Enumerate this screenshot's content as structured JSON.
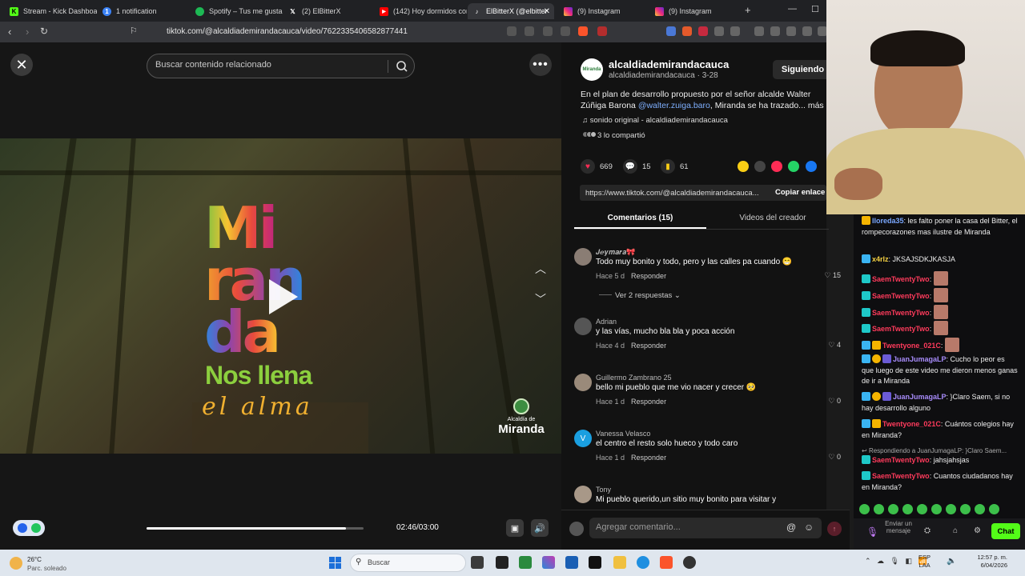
{
  "browser": {
    "tabs": [
      {
        "label": "Stream - Kick Dashboard",
        "icon": "kick-icon",
        "color": "#53fc18"
      },
      {
        "label": "1 notification",
        "icon": "notification-icon",
        "color": "#3b82f6"
      },
      {
        "label": "Spotify – Tus me gusta",
        "icon": "spotify-icon",
        "color": "#1db954"
      },
      {
        "label": "(2) ElBitterX",
        "icon": "x-icon",
        "color": "#000000"
      },
      {
        "label": "(142) Hoy dormidos con",
        "icon": "youtube-icon",
        "color": "#ff0000"
      },
      {
        "label": "ElBitterX (@elbitter",
        "icon": "tiktok-icon",
        "color": "#000000"
      },
      {
        "label": "(9) Instagram",
        "icon": "instagram-icon",
        "color": "#e1306c"
      },
      {
        "label": "(9) Instagram",
        "icon": "instagram-icon",
        "color": "#e1306c"
      }
    ],
    "url": "tiktok.com/@alcaldiademirandacauca/video/7622335406582877441"
  },
  "video": {
    "search_placeholder": "Buscar contenido relacionado",
    "logo_line1": "Mi",
    "logo_line2": "ran",
    "logo_line3": "da",
    "tagline1": "Nos llena",
    "tagline2": "el alma",
    "muni_top": "Alcaldía de",
    "muni_name": "Miranda",
    "time": "02:46/03:00",
    "progress": 0.92
  },
  "post": {
    "creator": "alcaldiademirandacauca",
    "creator_sub": "alcaldiademirandacauca · 3-28",
    "avatar_text": "Miranda",
    "follow_label": "Siguiendo",
    "desc_start": "En el plan de desarrollo propuesto por el señor alcalde Walter Zúñiga Barona ",
    "desc_mention": "@walter.zuiga.baro",
    "desc_end": ", Miranda se ha trazado... más",
    "sound": "sonido original - alcaldiademirandacauca",
    "shared": "3 lo compartió",
    "likes": "669",
    "comments": "15",
    "saves": "61",
    "link": "https://www.tiktok.com/@alcaldiademirandacauca...",
    "copy_label": "Copiar enlace",
    "tab_comments": "Comentarios (15)",
    "tab_videos": "Videos del creador",
    "view_replies": "Ver 2 respuestas",
    "reply_label": "Responder",
    "comment_placeholder": "Agregar comentario..."
  },
  "comments": [
    {
      "user": "𝑱𝒆𝒚𝒎𝒂𝒓𝒂🎀",
      "text": "Todo muy bonito y todo, pero y las calles pa cuando 😁",
      "age": "Hace 5 d",
      "likes": "15",
      "avatar": ""
    },
    {
      "user": "Adrian",
      "text": "y las vías, mucho bla bla y poca acción",
      "age": "Hace 4 d",
      "likes": "4",
      "avatar": ""
    },
    {
      "user": "Guillermo Zambrano 25",
      "text": "bello mi pueblo que me vio nacer y crecer 🥺",
      "age": "Hace 1 d",
      "likes": "0",
      "avatar": ""
    },
    {
      "user": "Vanessa Velasco",
      "text": "el centro el resto solo hueco y todo caro",
      "age": "Hace 1 d",
      "likes": "0",
      "avatar": "V"
    },
    {
      "user": "Tony",
      "text": "Mi pueblo querido,un sitio muy bonito para visitar y",
      "age": "",
      "likes": "",
      "avatar": ""
    }
  ],
  "chat": {
    "messages": [
      {
        "user": "lloreda35",
        "user_color": "#7aa7ff",
        "text": "les falto poner la casa del Bitter, el rompecorazones mas ilustre de Miranda"
      },
      {
        "user": "x4rlz",
        "user_color": "#f5d142",
        "text": "JKSAJSDKJKASJA"
      },
      {
        "user": "SaemTwentyTwo",
        "user_color": "#ff3b5c",
        "text": ""
      },
      {
        "user": "SaemTwentyTwo",
        "user_color": "#ff3b5c",
        "text": ""
      },
      {
        "user": "SaemTwentyTwo",
        "user_color": "#ff3b5c",
        "text": ""
      },
      {
        "user": "SaemTwentyTwo",
        "user_color": "#ff3b5c",
        "text": ""
      },
      {
        "user": "Twentyone_021C",
        "user_color": "#ff3b5c",
        "text": ""
      },
      {
        "user": "JuanJumagaLP",
        "user_color": "#a78bfa",
        "text": "Cucho lo peor es que luego de este video me dieron menos ganas de ir a Miranda"
      },
      {
        "user": "JuanJumagaLP",
        "user_color": "#a78bfa",
        "text": "}Claro Saem, si no hay desarrollo alguno"
      },
      {
        "user": "Twentyone_021C",
        "user_color": "#ff3b5c",
        "text": "Cuántos colegios hay en Miranda?"
      },
      {
        "reply_hint": "Respondiendo a JuanJumagaLP: }Claro Saem..."
      },
      {
        "user": "SaemTwentyTwo",
        "user_color": "#ff3b5c",
        "text": "jahsjahsjas"
      },
      {
        "user": "SaemTwentyTwo",
        "user_color": "#ff3b5c",
        "text": "Cuantos ciudadanos hay en Miranda?"
      }
    ],
    "send_label": "Enviar un mensaje",
    "chat_button": "Chat",
    "accent": "#53fc18"
  },
  "taskbar": {
    "temp": "26°C",
    "weather": "Parc. soleado",
    "search_placeholder": "Buscar",
    "lang1": "ESP",
    "lang2": "LAA",
    "time": "12:57 p. m.",
    "date": "6/04/2026"
  }
}
